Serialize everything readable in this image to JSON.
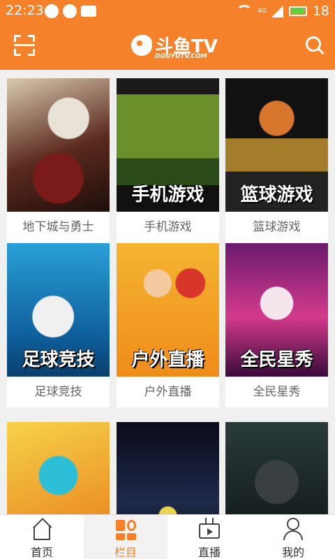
{
  "status_bar": {
    "time": "22:23",
    "network": "4G",
    "battery": "18",
    "colors": {
      "bar": "#f5822a",
      "battery_fill": "#5ad442"
    }
  },
  "header": {
    "logo_text": "斗鱼TV",
    "logo_subtitle": "DOUYUTV.COM",
    "icons": [
      "scan-icon",
      "search-icon"
    ],
    "accent_color": "#f5822a"
  },
  "categories": [
    {
      "label": "地下城与勇士",
      "thumb_text": ""
    },
    {
      "label": "手机游戏",
      "thumb_text": "手机游戏"
    },
    {
      "label": "篮球游戏",
      "thumb_text": "篮球游戏"
    },
    {
      "label": "足球竞技",
      "thumb_text": "足球竞技"
    },
    {
      "label": "户外直播",
      "thumb_text": "户外直播"
    },
    {
      "label": "全民星秀",
      "thumb_text": "全民星秀"
    },
    {
      "label": "",
      "thumb_text": ""
    },
    {
      "label": "",
      "thumb_text": ""
    },
    {
      "label": "",
      "thumb_text": ""
    }
  ],
  "tab_bar": {
    "tabs": [
      {
        "label": "首页",
        "icon": "home-icon",
        "active": false
      },
      {
        "label": "栏目",
        "icon": "grid-icon",
        "active": true
      },
      {
        "label": "直播",
        "icon": "tv-icon",
        "active": false
      },
      {
        "label": "我的",
        "icon": "person-icon",
        "active": false
      }
    ]
  }
}
